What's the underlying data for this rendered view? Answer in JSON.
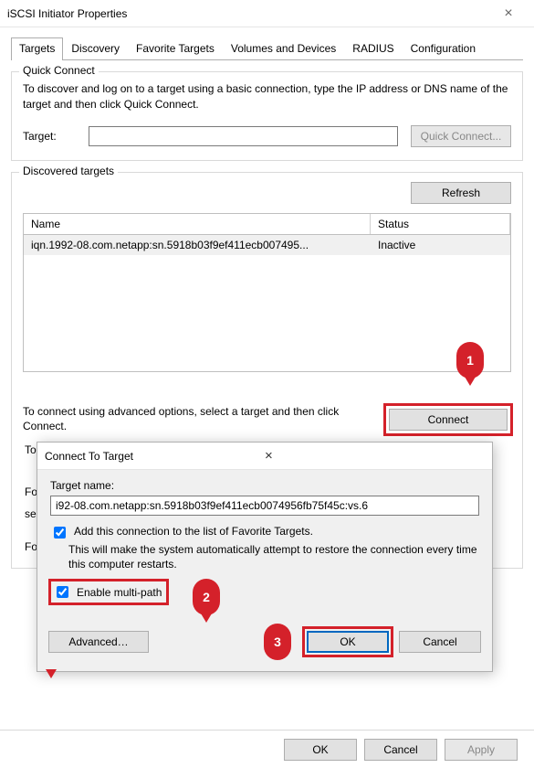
{
  "window": {
    "title": "iSCSI Initiator Properties",
    "close_glyph": "×"
  },
  "tabs": [
    "Targets",
    "Discovery",
    "Favorite Targets",
    "Volumes and Devices",
    "RADIUS",
    "Configuration"
  ],
  "quick_connect": {
    "legend": "Quick Connect",
    "hint": "To discover and log on to a target using a basic connection, type the IP address or DNS name of the target and then click Quick Connect.",
    "target_label": "Target:",
    "target_value": "",
    "button": "Quick Connect..."
  },
  "discovered": {
    "legend": "Discovered targets",
    "refresh": "Refresh",
    "columns": {
      "name": "Name",
      "status": "Status"
    },
    "rows": [
      {
        "name": "iqn.1992-08.com.netapp:sn.5918b03f9ef411ecb007495...",
        "status": "Inactive"
      }
    ],
    "connect_help": "To connect using advanced options, select a target and then click Connect.",
    "connect": "Connect",
    "stub_lines": [
      "To",
      "Fo",
      "se",
      "Fo"
    ]
  },
  "modal": {
    "title": "Connect To Target",
    "close_glyph": "×",
    "target_name_label": "Target name:",
    "target_name_value": "i92-08.com.netapp:sn.5918b03f9ef411ecb0074956fb75f45c:vs.6",
    "fav_label": "Add this connection to the list of Favorite Targets.",
    "fav_hint": "This will make the system automatically attempt to restore the connection every time this computer restarts.",
    "multipath_label": "Enable multi-path",
    "advanced": "Advanced…",
    "ok": "OK",
    "cancel": "Cancel"
  },
  "footer": {
    "ok": "OK",
    "cancel": "Cancel",
    "apply": "Apply"
  },
  "markers": {
    "one": "1",
    "two": "2",
    "three": "3"
  }
}
